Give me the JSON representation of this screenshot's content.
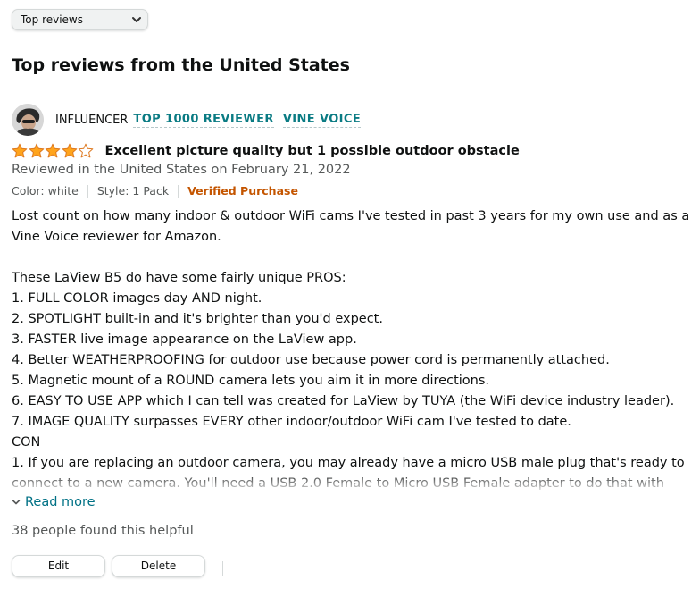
{
  "sort": {
    "selected": "Top reviews"
  },
  "heading": "Top reviews from the United States",
  "reviewer": {
    "name": "INFLUENCER",
    "badges": [
      "TOP 1000 REVIEWER",
      "VINE VOICE"
    ]
  },
  "review": {
    "rating": 4,
    "rating_max": 5,
    "title": "Excellent picture quality but 1 possible outdoor obstacle",
    "date_line": "Reviewed in the United States on February 21, 2022",
    "color": "Color: white",
    "style": "Style: 1 Pack",
    "verified": "Verified Purchase",
    "body": [
      "Lost count on how many indoor & outdoor WiFi cams I've tested in past 3 years for my own use and as a Vine Voice reviewer for Amazon.",
      "",
      "These LaView B5 do have some fairly unique PROS:",
      "1. FULL COLOR images day AND night.",
      "2. SPOTLIGHT built-in and it's brighter than you'd expect.",
      "3. FASTER live image appearance on the LaView app.",
      "4. Better WEATHERPROOFING for outdoor use because power cord is permanently attached.",
      "5. Magnetic mount of a ROUND camera lets you aim it in more directions.",
      "6. EASY TO USE APP which I can tell was created for LaView by TUYA (the WiFi device industry leader).",
      "7. IMAGE QUALITY surpasses EVERY other indoor/outdoor WiFi cam I've tested to date.",
      "CON",
      "1. If you are replacing an outdoor camera, you may already have a micro USB male plug that's ready to connect to a new camera. You'll need a USB 2.0 Female to Micro USB Female adapter to do that with"
    ],
    "read_more": "Read more",
    "helpful": "38 people found this helpful"
  },
  "actions": {
    "edit": "Edit",
    "delete": "Delete"
  },
  "colors": {
    "badge": "#0a7b83",
    "star": "#ffa41c",
    "verified": "#c45500",
    "link": "#007185",
    "muted": "#565959"
  },
  "icons": {
    "sort_chevron": "chevron-down-icon",
    "read_more": "chevron-down-icon",
    "star_full": "star-filled-icon",
    "star_empty": "star-empty-icon"
  }
}
